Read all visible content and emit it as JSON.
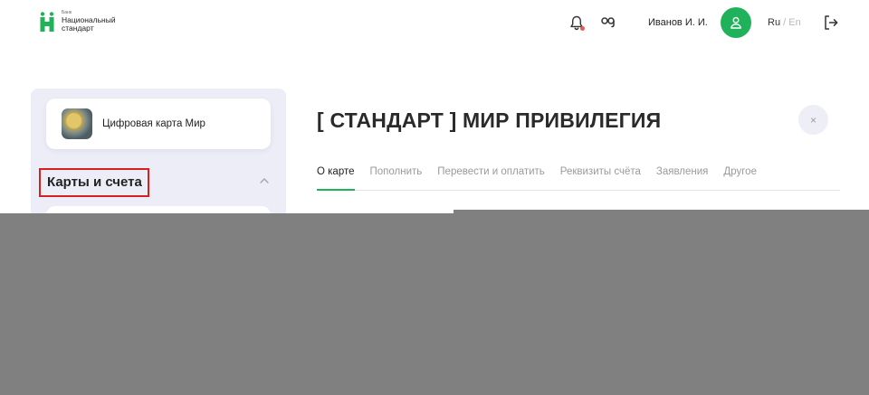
{
  "header": {
    "logo_small": "Банк",
    "logo_line1": "Национальный",
    "logo_line2": "стандарт",
    "user_name": "Иванов И. И.",
    "lang_active": "Ru",
    "lang_sep": "/",
    "lang_inactive": "En",
    "icons": [
      "bell-icon",
      "links-icon",
      "user-icon",
      "logout-icon"
    ],
    "accent_color": "#1fb25a",
    "notification_dot_color": "#e8594f"
  },
  "sidebar": {
    "card_title": "Цифровая карта Мир",
    "section_title": "Карты и счета"
  },
  "main": {
    "title": "[ СТАНДАРТ ] МИР ПРИВИЛЕГИЯ",
    "close_symbol": "×",
    "tabs": [
      {
        "label": "О карте",
        "active": true
      },
      {
        "label": "Пополнить",
        "active": false
      },
      {
        "label": "Перевести и оплатить",
        "active": false
      },
      {
        "label": "Реквизиты счёта",
        "active": false
      },
      {
        "label": "Заявления",
        "active": false
      },
      {
        "label": "Другое",
        "active": false
      }
    ]
  }
}
